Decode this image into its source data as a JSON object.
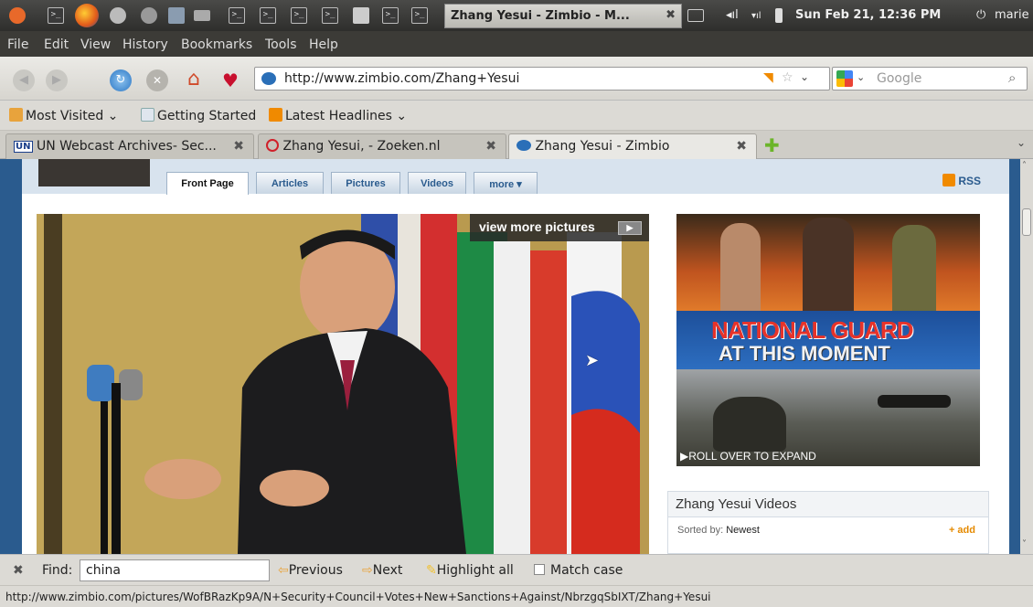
{
  "panel": {
    "window_title": "Zhang Yesui - Zimbio - M...",
    "clock": "Sun Feb 21, 12:36 PM",
    "user": "marie",
    "terminal_glyph": ">_"
  },
  "menu": [
    "File",
    "Edit",
    "View",
    "History",
    "Bookmarks",
    "Tools",
    "Help"
  ],
  "navigation": {
    "url": "http://www.zimbio.com/Zhang+Yesui",
    "search_engine": "Google",
    "search_placeholder": "Google"
  },
  "bookmarks": [
    {
      "label": "Most Visited",
      "dropdown": true
    },
    {
      "label": "Getting Started",
      "dropdown": false
    },
    {
      "label": "Latest Headlines",
      "dropdown": true
    }
  ],
  "tabs": [
    {
      "label": "UN Webcast Archives- Sec...",
      "favicon_text": "UN",
      "active": false
    },
    {
      "label": "Zhang Yesui, - Zoeken.nl",
      "active": false
    },
    {
      "label": "Zhang Yesui - Zimbio",
      "active": true
    }
  ],
  "site": {
    "nav": [
      "Front Page",
      "Articles",
      "Pictures",
      "Videos",
      "more"
    ],
    "rss": "RSS",
    "view_more": "view more pictures",
    "ad": {
      "line1": "NATIONAL GUARD",
      "line2": "AT THIS MOMENT",
      "cta": "ROLL OVER TO EXPAND"
    },
    "videos": {
      "title": "Zhang Yesui Videos",
      "sorted_label": "Sorted by:",
      "sorted_value": "Newest",
      "add": "+ add"
    }
  },
  "find": {
    "label": "Find:",
    "value": "china",
    "previous": "Previous",
    "next": "Next",
    "highlight": "Highlight all",
    "match_case": "Match case"
  },
  "status": "http://www.zimbio.com/pictures/WofBRazKp9A/N+Security+Council+Votes+New+Sanctions+Against/NbrzgqSbIXT/Zhang+Yesui",
  "colors": {
    "zimbio_blue": "#2a5b8e",
    "ubuntu_dark": "#3c3b37",
    "accent_orange": "#e58a00"
  }
}
